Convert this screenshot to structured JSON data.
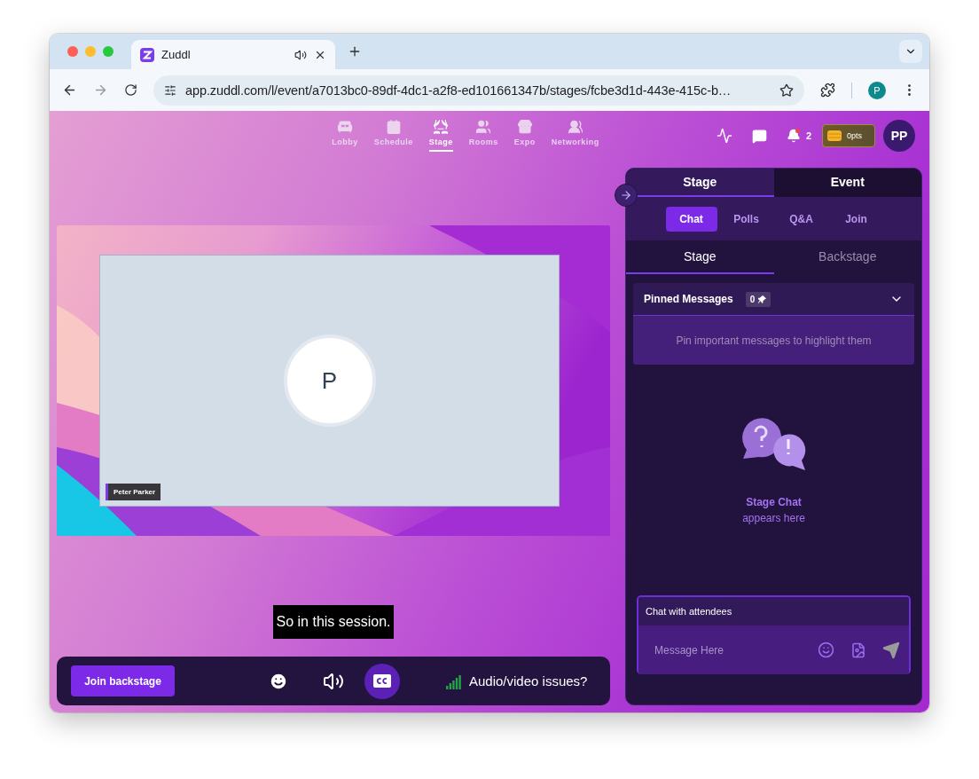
{
  "browser": {
    "tab_title": "Zuddl",
    "url": "app.zuddl.com/l/event/a7013bc0-89df-4dc1-a2f8-ed101661347b/stages/fcbe3d1d-443e-415c-b…",
    "profile_initial": "P"
  },
  "nav": [
    {
      "kind": "lobby",
      "label": "Lobby",
      "selected": false
    },
    {
      "kind": "schedule",
      "label": "Schedule",
      "selected": false
    },
    {
      "kind": "stage",
      "label": "Stage",
      "selected": true
    },
    {
      "kind": "rooms",
      "label": "Rooms",
      "selected": false
    },
    {
      "kind": "expo",
      "label": "Expo",
      "selected": false
    },
    {
      "kind": "networking",
      "label": "Networking",
      "selected": false
    }
  ],
  "header": {
    "notification_count": "2",
    "points": "0pts",
    "avatar_initials": "PP"
  },
  "stage": {
    "participant_initial": "P",
    "participant_name": "Peter Parker",
    "caption": "So in this session."
  },
  "controls": {
    "join_label": "Join backstage",
    "captions_on": true,
    "issues_label": "Audio/video issues?"
  },
  "panel": {
    "scope_tabs": [
      {
        "label": "Stage",
        "selected": true
      },
      {
        "label": "Event",
        "selected": false
      }
    ],
    "feature_tabs": [
      {
        "label": "Chat",
        "selected": true
      },
      {
        "label": "Polls",
        "selected": false
      },
      {
        "label": "Q&A",
        "selected": false
      },
      {
        "label": "Join",
        "selected": false
      }
    ],
    "chat_tabs": [
      {
        "label": "Stage",
        "selected": true
      },
      {
        "label": "Backstage",
        "selected": false
      }
    ],
    "pinned": {
      "title": "Pinned Messages",
      "count": "0",
      "empty_text": "Pin important messages to highlight them"
    },
    "empty_state": {
      "title": "Stage Chat",
      "subtitle": "appears here"
    },
    "composer": {
      "label": "Chat with attendees",
      "placeholder": "Message Here"
    }
  }
}
